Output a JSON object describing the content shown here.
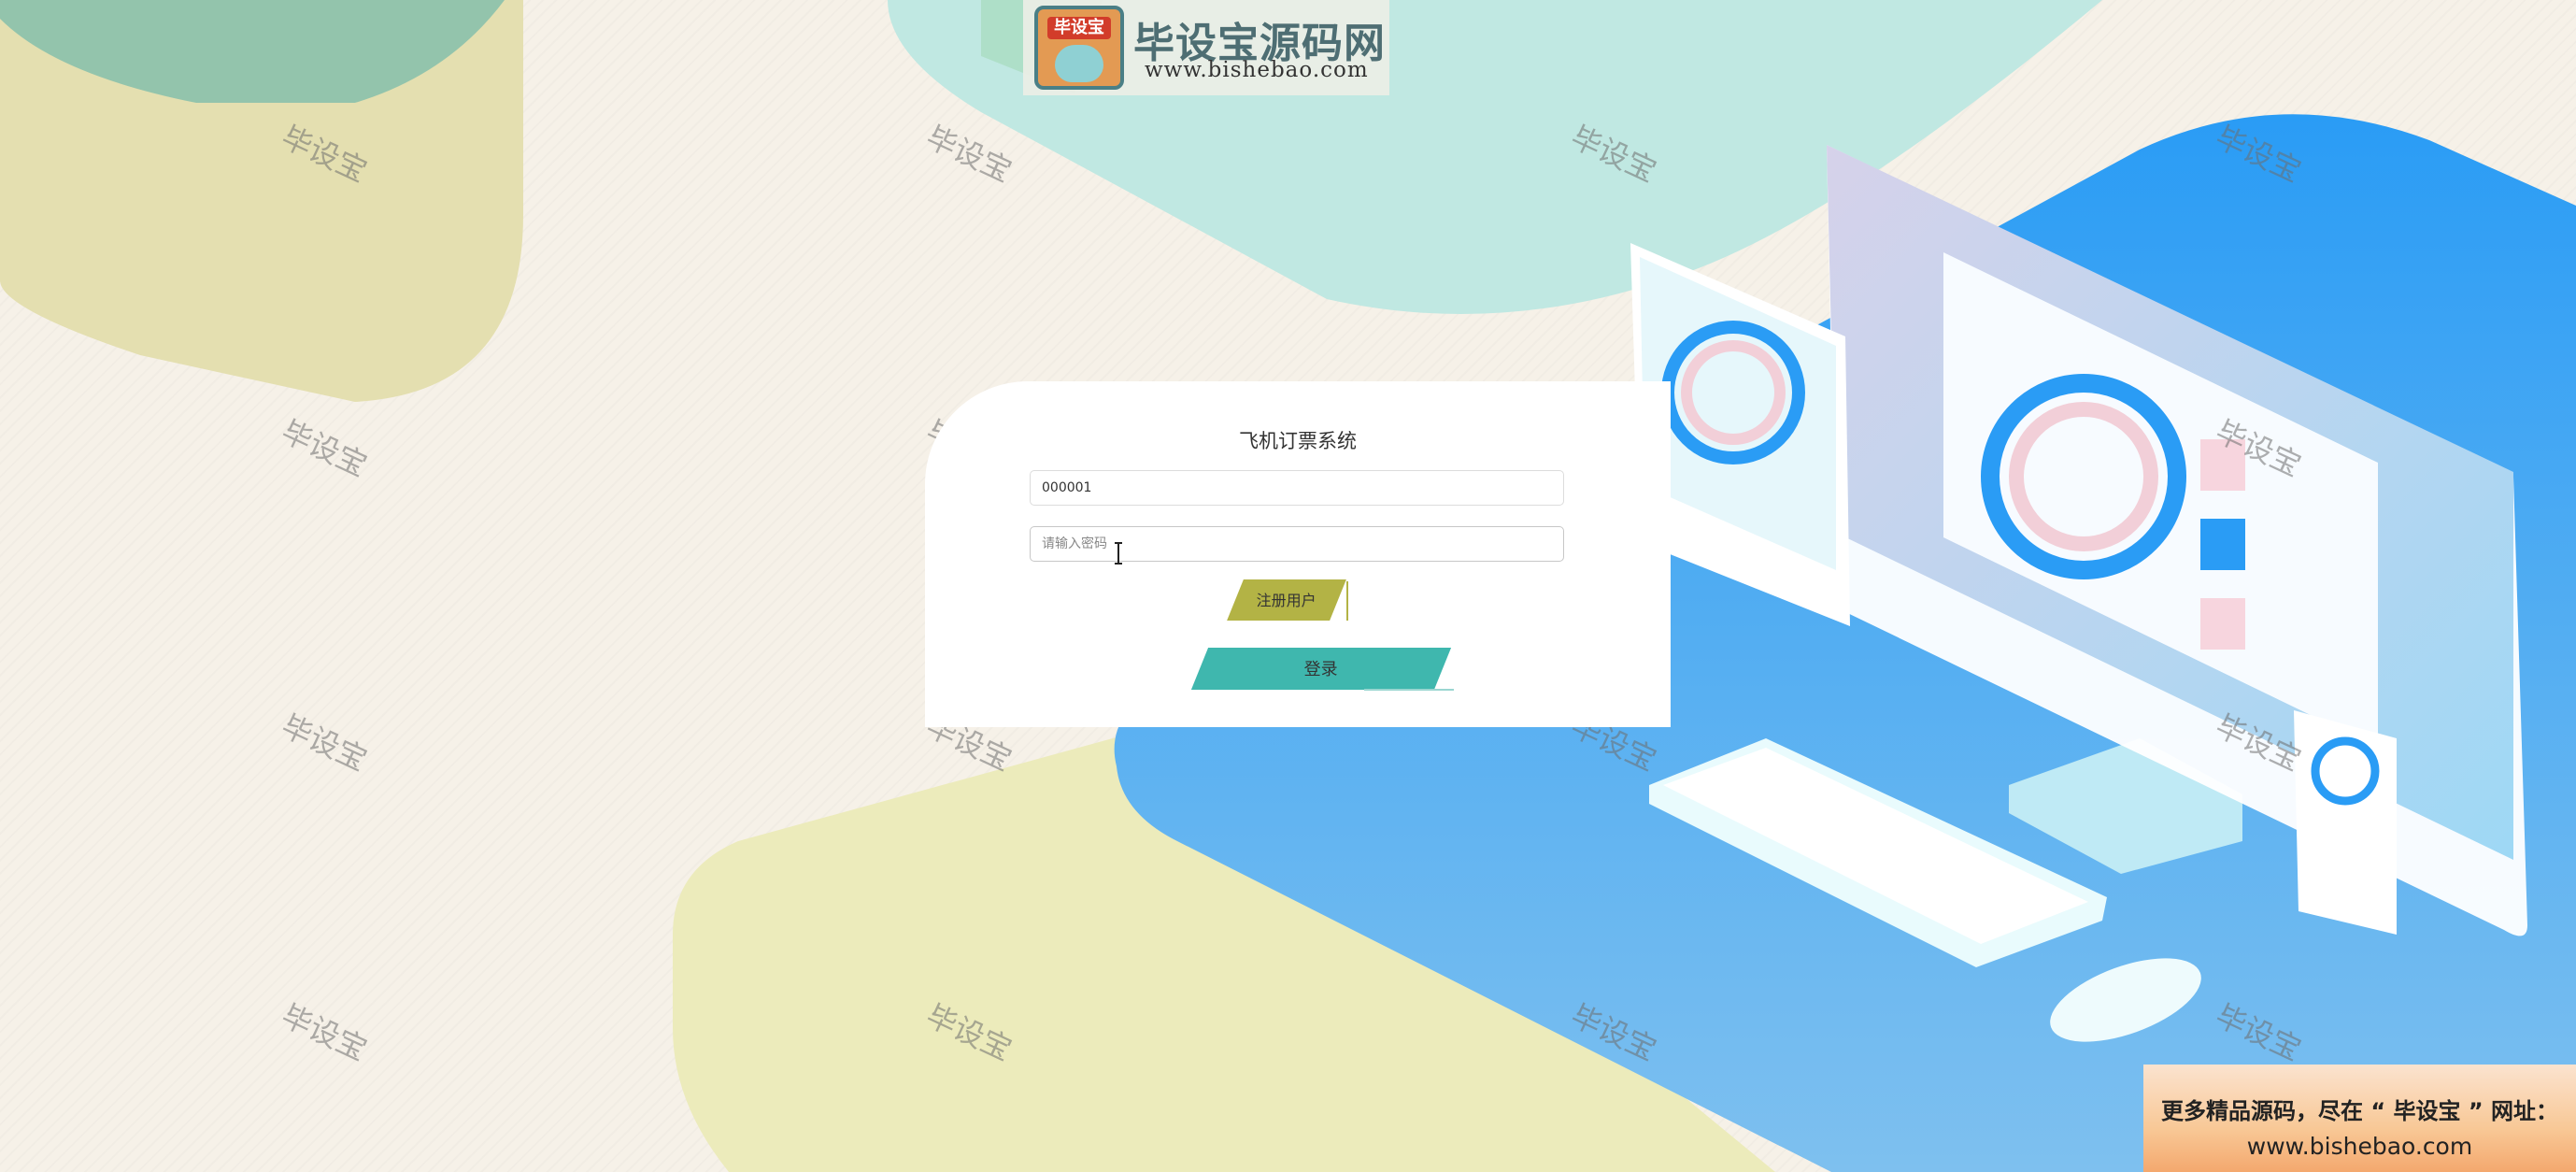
{
  "header": {
    "logo_badge": "毕设宝",
    "logo_title": "毕设宝源码网",
    "logo_url": "www.bishebao.com"
  },
  "watermark": "毕设宝",
  "login": {
    "title": "飞机订票系统",
    "username_value": "000001",
    "password_placeholder": "请输入密码",
    "register_label": "注册用户",
    "login_label": "登录"
  },
  "promo": {
    "line1": "更多精品源码，尽在 “ 毕设宝 ” 网址：",
    "line2": "www.bishebao.com"
  },
  "colors": {
    "register_button": "#b3b345",
    "login_button": "#3fb7ae",
    "background": "#f6f1e8",
    "accent_blue": "#2b9cf2"
  }
}
